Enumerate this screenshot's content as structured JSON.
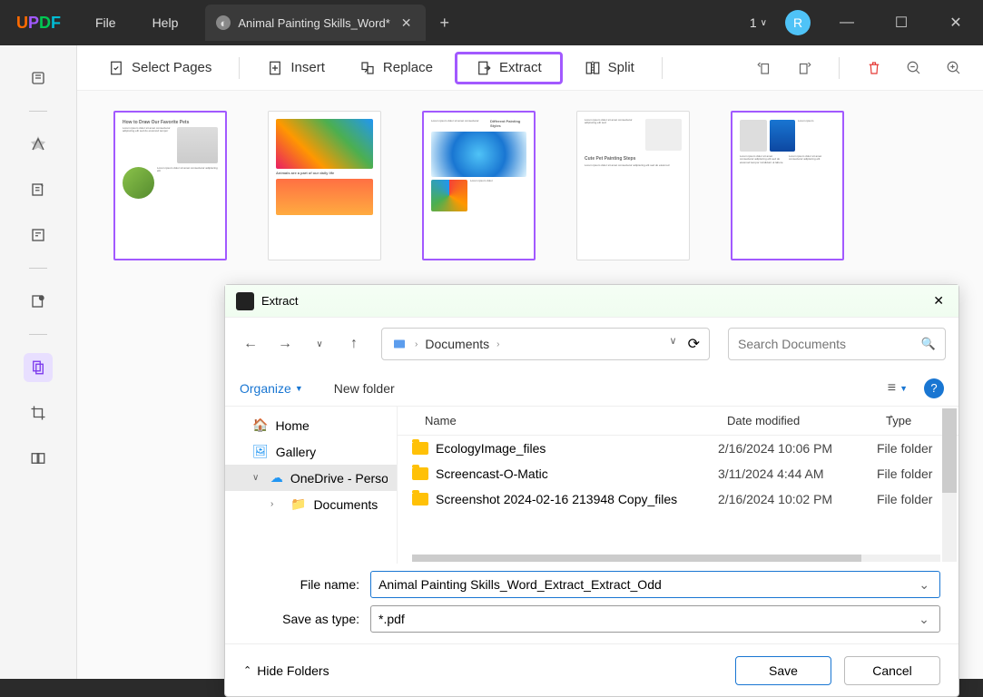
{
  "titlebar": {
    "logo": "UPDF",
    "menu": {
      "file": "File",
      "help": "Help"
    },
    "tab_title": "Animal Painting Skills_Word*",
    "one_label": "1",
    "avatar_letter": "R"
  },
  "toolbar": {
    "select_pages": "Select Pages",
    "insert": "Insert",
    "replace": "Replace",
    "extract": "Extract",
    "split": "Split"
  },
  "thumbnails": {
    "titles": [
      "How to Draw Our Favorite Pets",
      "Animals are a part of our daily life",
      "Different Painting Styles",
      "Cute Pet Painting Steps",
      ""
    ]
  },
  "dialog": {
    "title": "Extract",
    "breadcrumb": "Documents",
    "search_placeholder": "Search Documents",
    "organize": "Organize",
    "new_folder": "New folder",
    "tree": {
      "home": "Home",
      "gallery": "Gallery",
      "onedrive": "OneDrive - Personal",
      "documents": "Documents"
    },
    "columns": {
      "name": "Name",
      "date": "Date modified",
      "type": "Type"
    },
    "files": [
      {
        "name": "EcologyImage_files",
        "date": "2/16/2024 10:06 PM",
        "type": "File folder"
      },
      {
        "name": "Screencast-O-Matic",
        "date": "3/11/2024 4:44 AM",
        "type": "File folder"
      },
      {
        "name": "Screenshot 2024-02-16 213948 Copy_files",
        "date": "2/16/2024 10:02 PM",
        "type": "File folder"
      }
    ],
    "file_name_label": "File name:",
    "file_name_value": "Animal Painting Skills_Word_Extract_Extract_Odd",
    "save_type_label": "Save as type:",
    "save_type_value": "*.pdf",
    "hide_folders": "Hide Folders",
    "save": "Save",
    "cancel": "Cancel"
  }
}
